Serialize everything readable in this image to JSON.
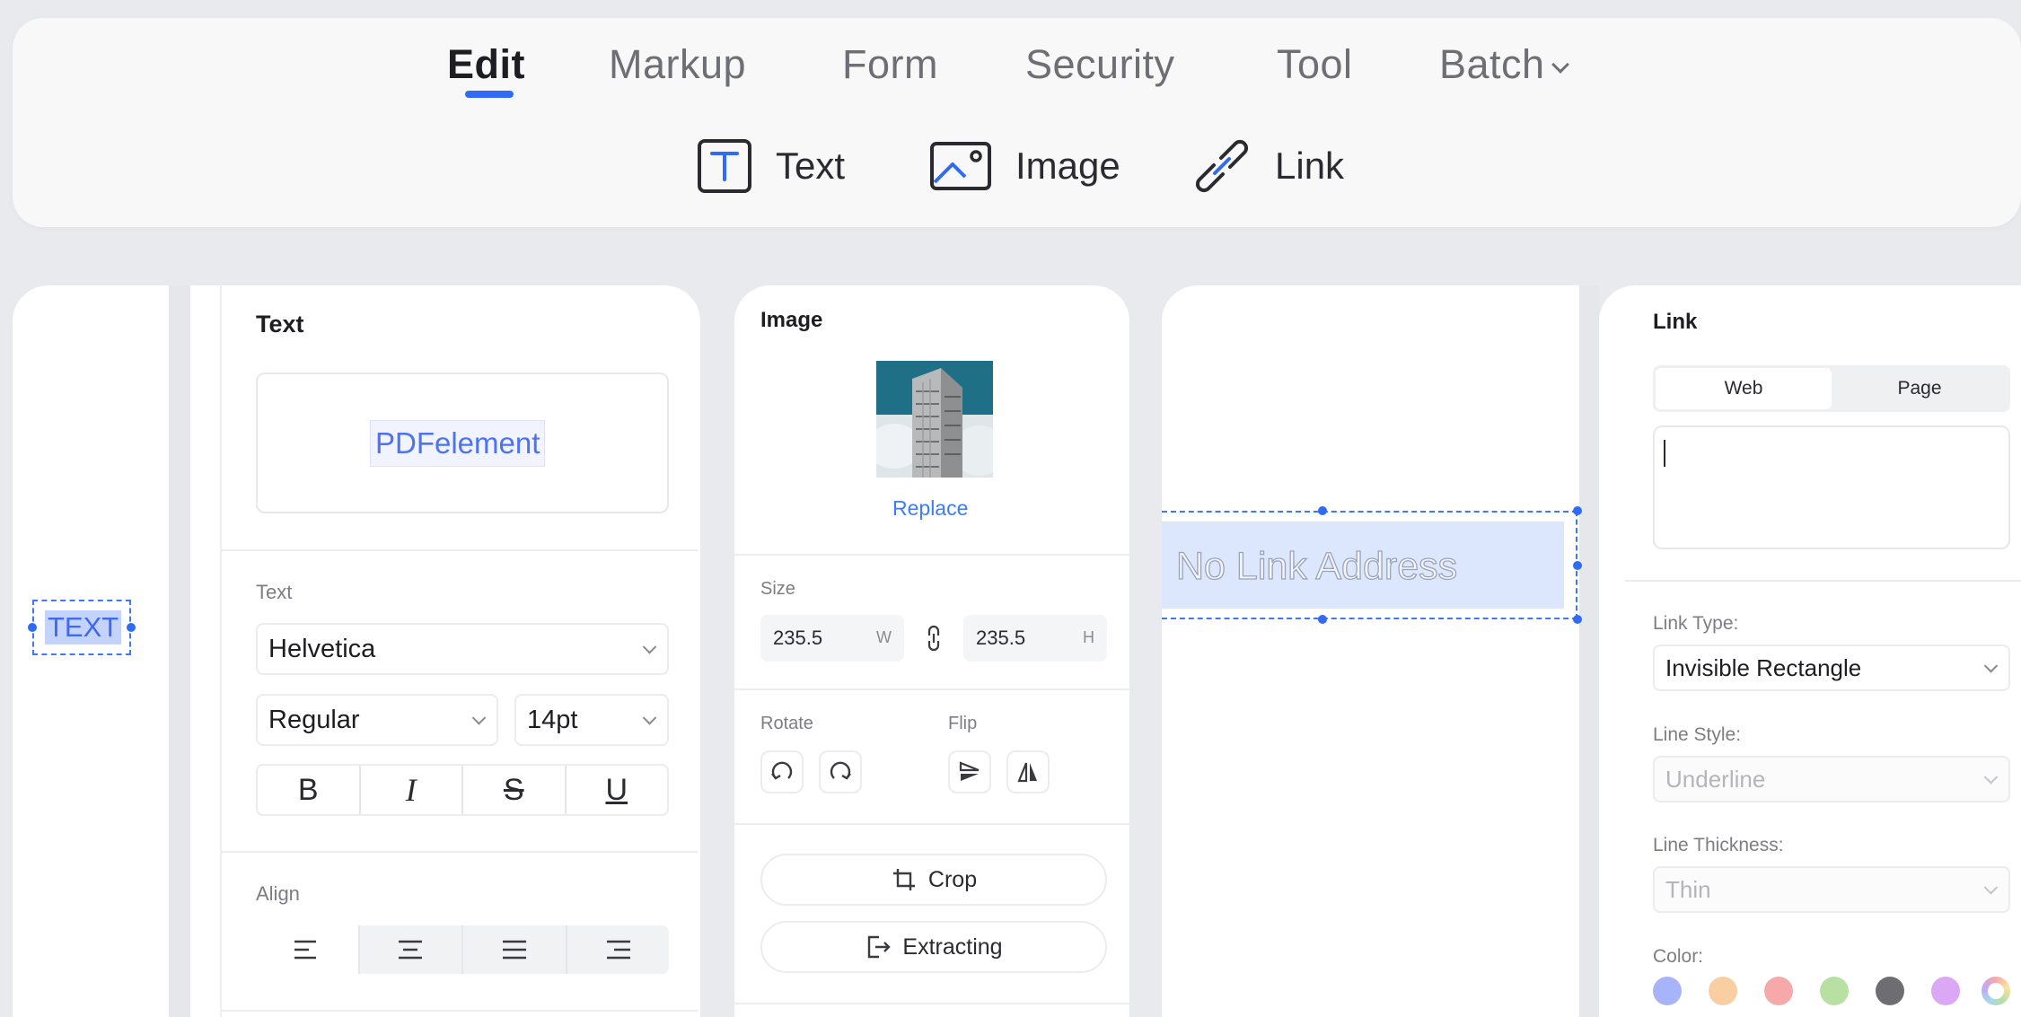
{
  "tabs": [
    {
      "label": "Edit",
      "active": true
    },
    {
      "label": "Markup"
    },
    {
      "label": "Form"
    },
    {
      "label": "Security"
    },
    {
      "label": "Tool"
    },
    {
      "label": "Batch"
    }
  ],
  "tools": [
    {
      "label": "Text",
      "icon": "text-box-icon"
    },
    {
      "label": "Image",
      "icon": "image-icon"
    },
    {
      "label": "Link",
      "icon": "link-icon"
    }
  ],
  "canvas_text": {
    "label": "TEXT"
  },
  "text_panel": {
    "title": "Text",
    "preview": "PDFelement",
    "section_label": "Text",
    "font_family": "Helvetica",
    "font_weight": "Regular",
    "font_size": "14pt",
    "styles": [
      "B",
      "I",
      "S",
      "U"
    ],
    "align_label": "Align"
  },
  "image_panel": {
    "title": "Image",
    "replace_label": "Replace",
    "size_label": "Size",
    "width": "235.5",
    "width_unit": "W",
    "height": "235.5",
    "height_unit": "H",
    "rotate_label": "Rotate",
    "flip_label": "Flip",
    "crop_label": "Crop",
    "extract_label": "Extracting"
  },
  "link_canvas": {
    "placeholder": "No Link Address"
  },
  "link_panel": {
    "title": "Link",
    "tabs": [
      "Web",
      "Page"
    ],
    "link_type_label": "Link Type:",
    "link_type_value": "Invisible Rectangle",
    "line_style_label": "Line Style:",
    "line_style_value": "Underline",
    "line_thickness_label": "Line Thickness:",
    "line_thickness_value": "Thin",
    "color_label": "Color:",
    "colors": [
      "#a7b4fa",
      "#f9cfa2",
      "#f7a9a9",
      "#b7e0a2",
      "#6e6e72",
      "#dba8f5",
      "multicolor"
    ]
  },
  "accent": "#2f6bf5"
}
